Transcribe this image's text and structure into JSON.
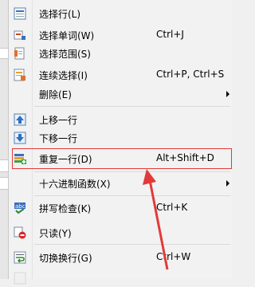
{
  "menu": {
    "items": [
      {
        "label": "选择行(L)",
        "shortcut": "",
        "icon": "select-line-icon",
        "submenu": false
      },
      {
        "label": "选择单词(W)",
        "shortcut": "Ctrl+J",
        "icon": "select-word-icon",
        "submenu": false
      },
      {
        "label": "选择范围(S)",
        "shortcut": "",
        "icon": "select-range-icon",
        "submenu": false
      },
      {
        "label": "连续选择(I)",
        "shortcut": "Ctrl+P, Ctrl+S",
        "icon": "continuous-select-icon",
        "submenu": false
      },
      {
        "label": "删除(E)",
        "shortcut": "",
        "icon": "",
        "submenu": true
      },
      {
        "label": "上移一行",
        "shortcut": "",
        "icon": "move-up-icon",
        "submenu": false
      },
      {
        "label": "下移一行",
        "shortcut": "",
        "icon": "move-down-icon",
        "submenu": false
      },
      {
        "label": "重复一行(D)",
        "shortcut": "Alt+Shift+D",
        "icon": "duplicate-line-icon",
        "submenu": false
      },
      {
        "label": "十六进制函数(X)",
        "shortcut": "",
        "icon": "",
        "submenu": true
      },
      {
        "label": "拼写检查(K)",
        "shortcut": "Ctrl+K",
        "icon": "spell-check-icon",
        "submenu": false
      },
      {
        "label": "只读(Y)",
        "shortcut": "",
        "icon": "read-only-icon",
        "submenu": false
      },
      {
        "label": "切换换行(G)",
        "shortcut": "Ctrl+W",
        "icon": "toggle-wrap-icon",
        "submenu": false
      }
    ],
    "highlighted_item": "重复一行(D)"
  },
  "annotation": {
    "color": "#e23a3a"
  }
}
